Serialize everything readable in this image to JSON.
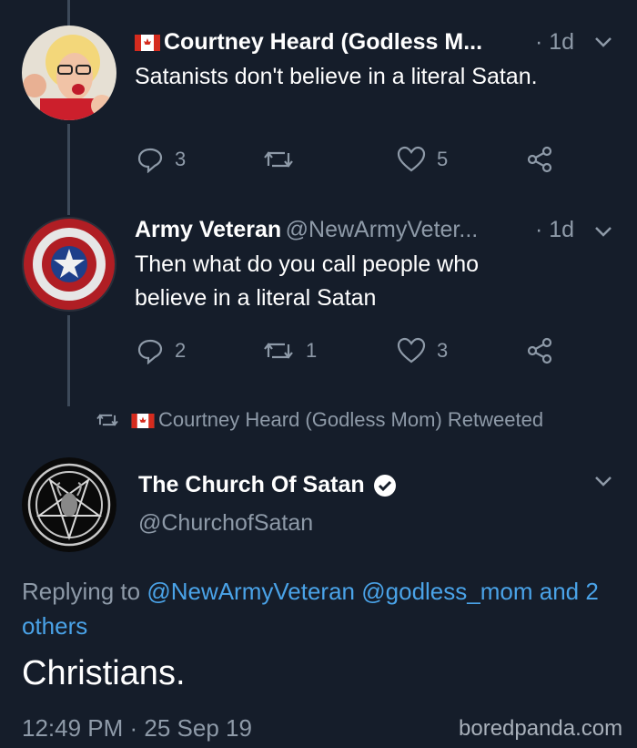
{
  "tweets": [
    {
      "author": "Courtney Heard (Godless M...",
      "time": "· 1d",
      "text": "Satanists don't believe in a literal Satan.",
      "replies": "3",
      "retweets": "",
      "likes": "5"
    },
    {
      "author": "Army Veteran",
      "handle": "@NewArmyVeter...",
      "time": "· 1d",
      "text": "Then what do you call people who believe in a literal Satan",
      "replies": "2",
      "retweets": "1",
      "likes": "3"
    }
  ],
  "retweet_banner": "Courtney Heard (Godless Mom) Retweeted",
  "main_tweet": {
    "author": "The Church Of Satan",
    "handle": "@ChurchofSatan",
    "replying_prefix": "Replying to",
    "mention1": "@NewArmyVeteran",
    "mention2": "@godless_mom",
    "others": "and 2 others",
    "text": "Christians.",
    "timestamp": "12:49 PM · 25 Sep 19"
  },
  "watermark": "boredpanda.com",
  "colors": {
    "background": "#151d2a",
    "link": "#4aa3e8",
    "muted": "#8e9aa8"
  }
}
